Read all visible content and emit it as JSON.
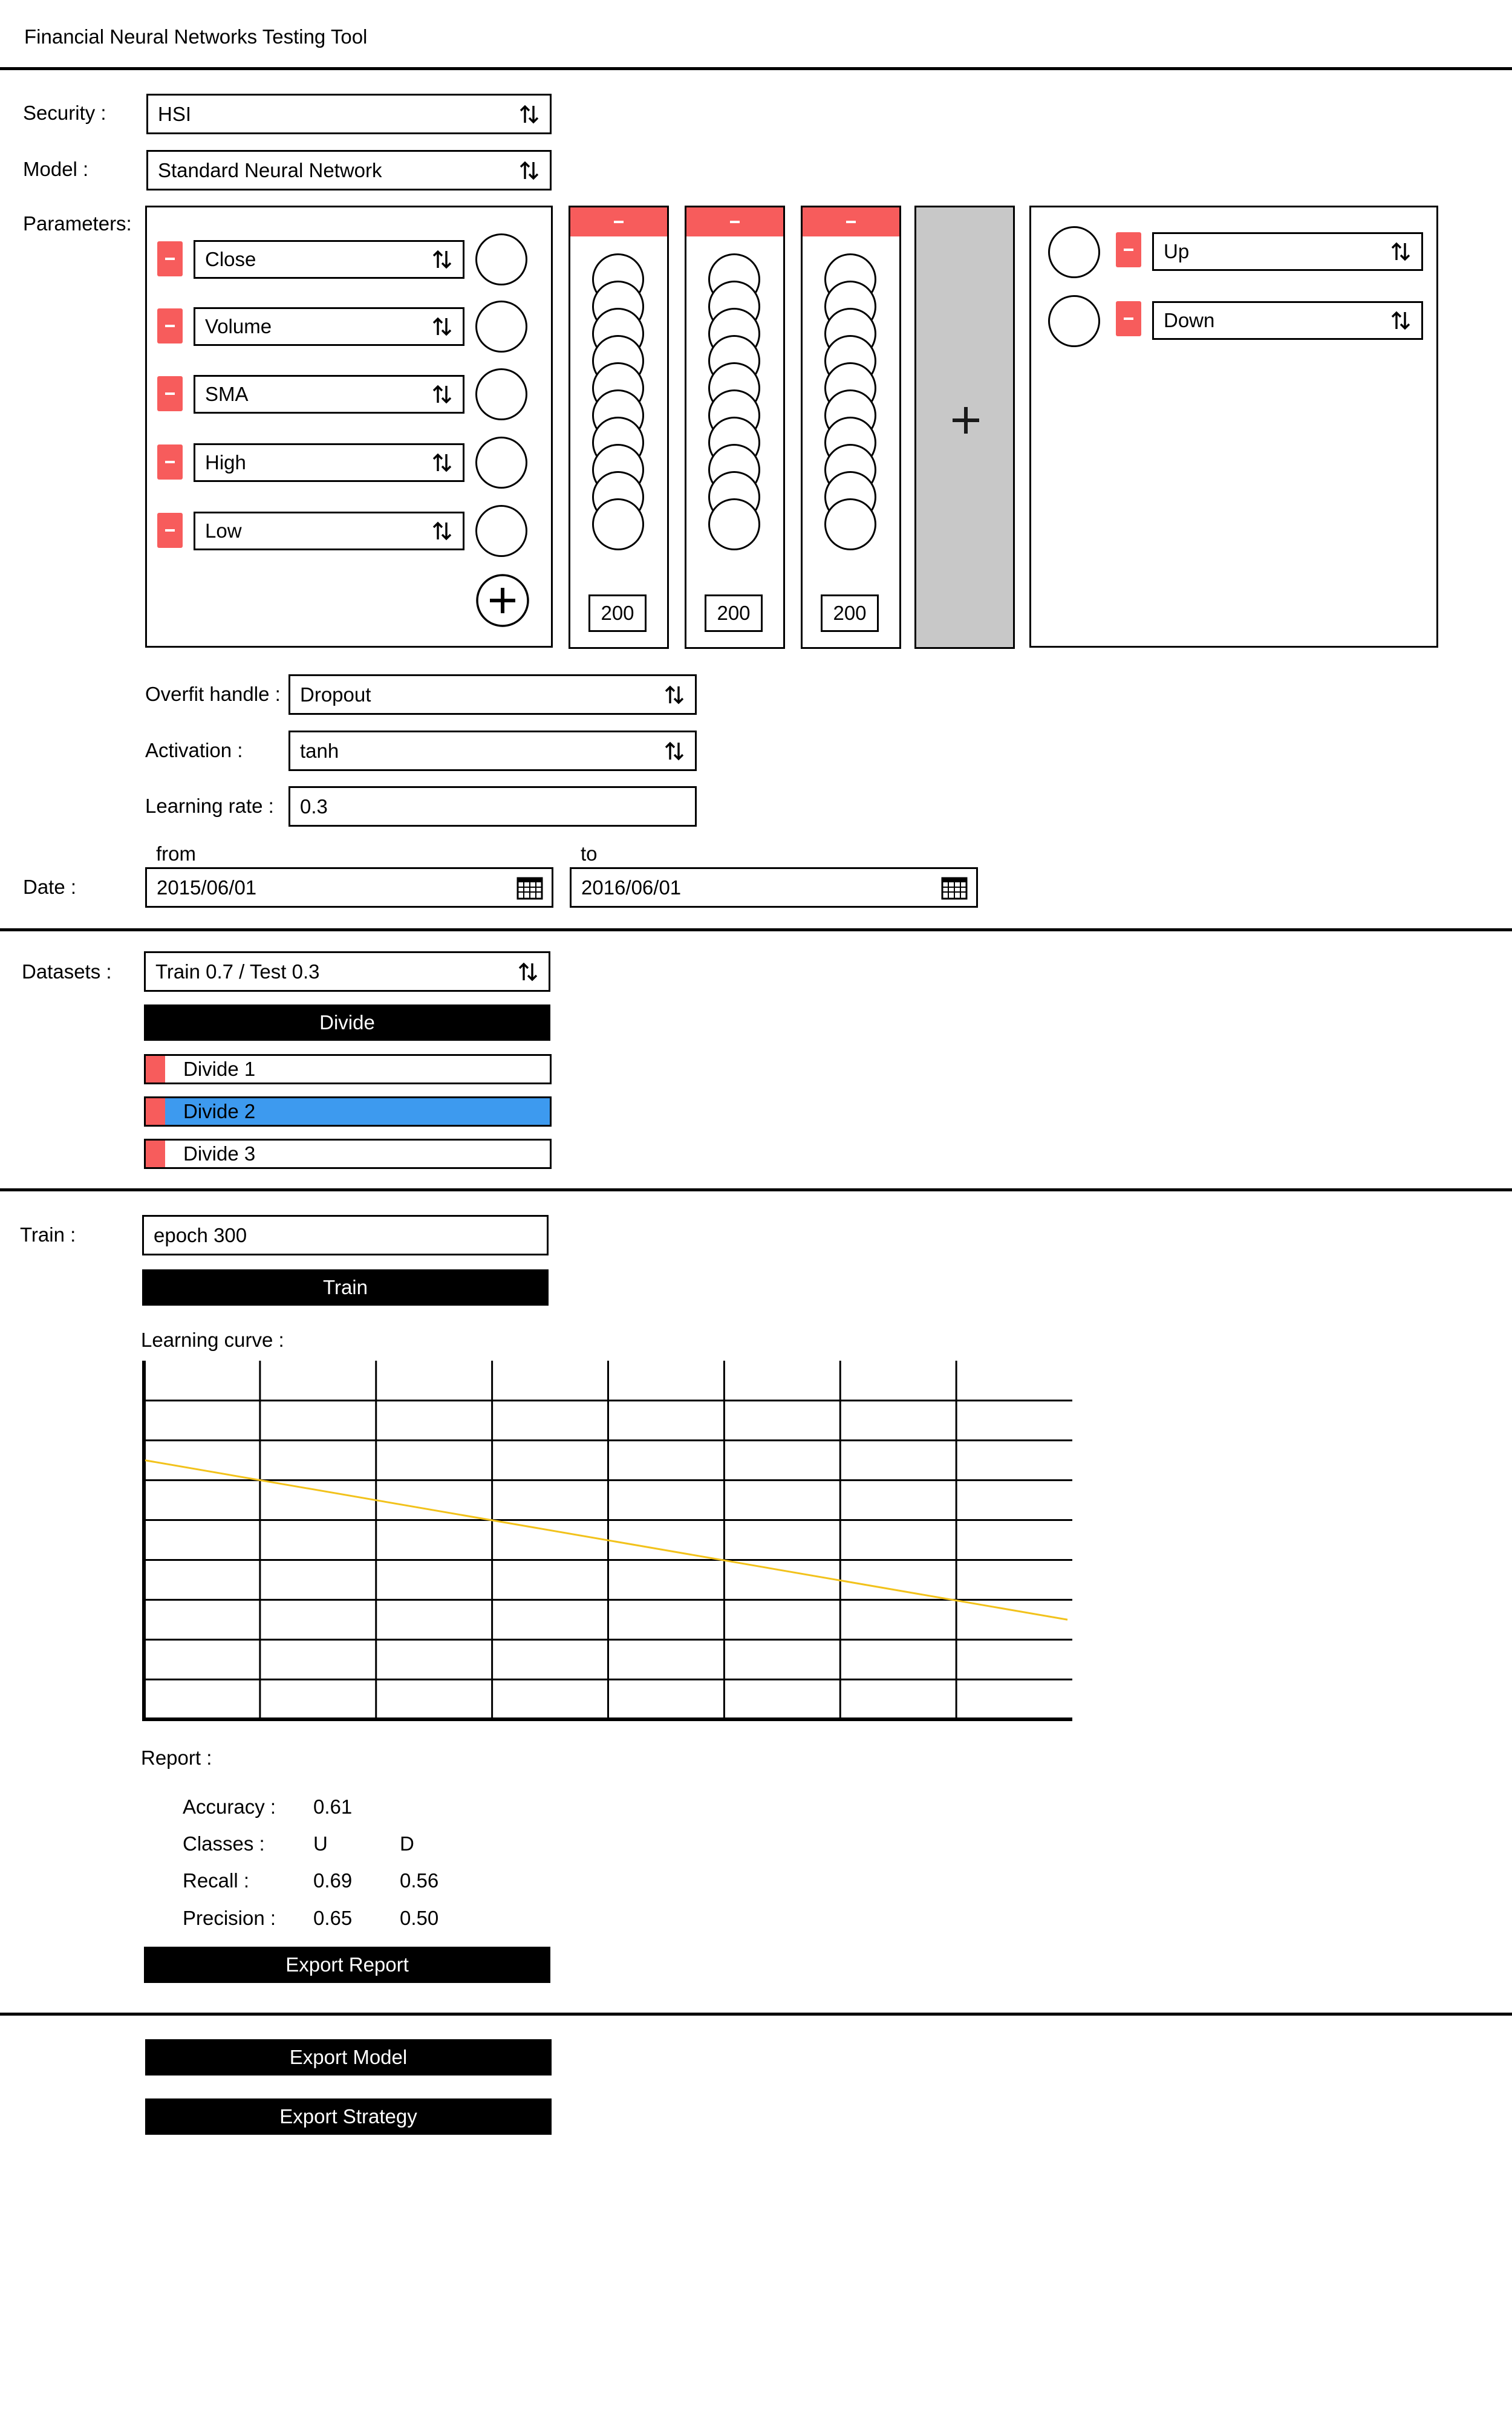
{
  "app": {
    "title": "Financial Neural Networks Testing Tool"
  },
  "security": {
    "label": "Security :",
    "value": "HSI"
  },
  "model": {
    "label": "Model :",
    "value": "Standard Neural Network"
  },
  "parameters": {
    "label": "Parameters:",
    "inputs": [
      "Close",
      "Volume",
      "SMA",
      "High",
      "Low"
    ],
    "hidden_layers": [
      "200",
      "200",
      "200"
    ],
    "outputs": [
      "Up",
      "Down"
    ]
  },
  "overfit": {
    "label": "Overfit handle :",
    "value": "Dropout"
  },
  "activation": {
    "label": "Activation :",
    "value": "tanh"
  },
  "learning_rate": {
    "label": "Learning rate :",
    "value": "0.3"
  },
  "date": {
    "label": "Date :",
    "from_label": "from",
    "to_label": "to",
    "from": "2015/06/01",
    "to": "2016/06/01"
  },
  "datasets": {
    "label": "Datasets :",
    "value": "Train 0.7 / Test 0.3",
    "divide_label": "Divide",
    "items": [
      "Divide 1",
      "Divide 2",
      "Divide 3"
    ],
    "selected_index": 1
  },
  "train": {
    "label": "Train :",
    "epoch": "epoch 300",
    "button": "Train"
  },
  "learning_curve": {
    "label": "Learning curve :"
  },
  "chart_data": {
    "type": "line",
    "title": "",
    "xlabel": "",
    "ylabel": "",
    "grid": true,
    "series": [
      {
        "values": [
          6.5,
          2.5
        ],
        "color": "#f2c21b"
      }
    ]
  },
  "report": {
    "label": "Report :",
    "accuracy_label": "Accuracy :",
    "accuracy": "0.61",
    "classes_label": "Classes :",
    "class_u": "U",
    "class_d": "D",
    "recall_label": "Recall :",
    "recall_u": "0.69",
    "recall_d": "0.56",
    "precision_label": "Precision :",
    "precision_u": "0.65",
    "precision_d": "0.50",
    "export_label": "Export Report"
  },
  "exports": {
    "model": "Export Model",
    "strategy": "Export Strategy"
  },
  "colors": {
    "remove": "#f75c5c",
    "selected": "#3d9aef",
    "curve": "#f2c21b",
    "add_panel": "#c8c8c8"
  },
  "icons": {
    "select": "updown-arrows-icon",
    "calendar": "calendar-icon",
    "add": "plus-icon",
    "remove": "minus-icon"
  }
}
